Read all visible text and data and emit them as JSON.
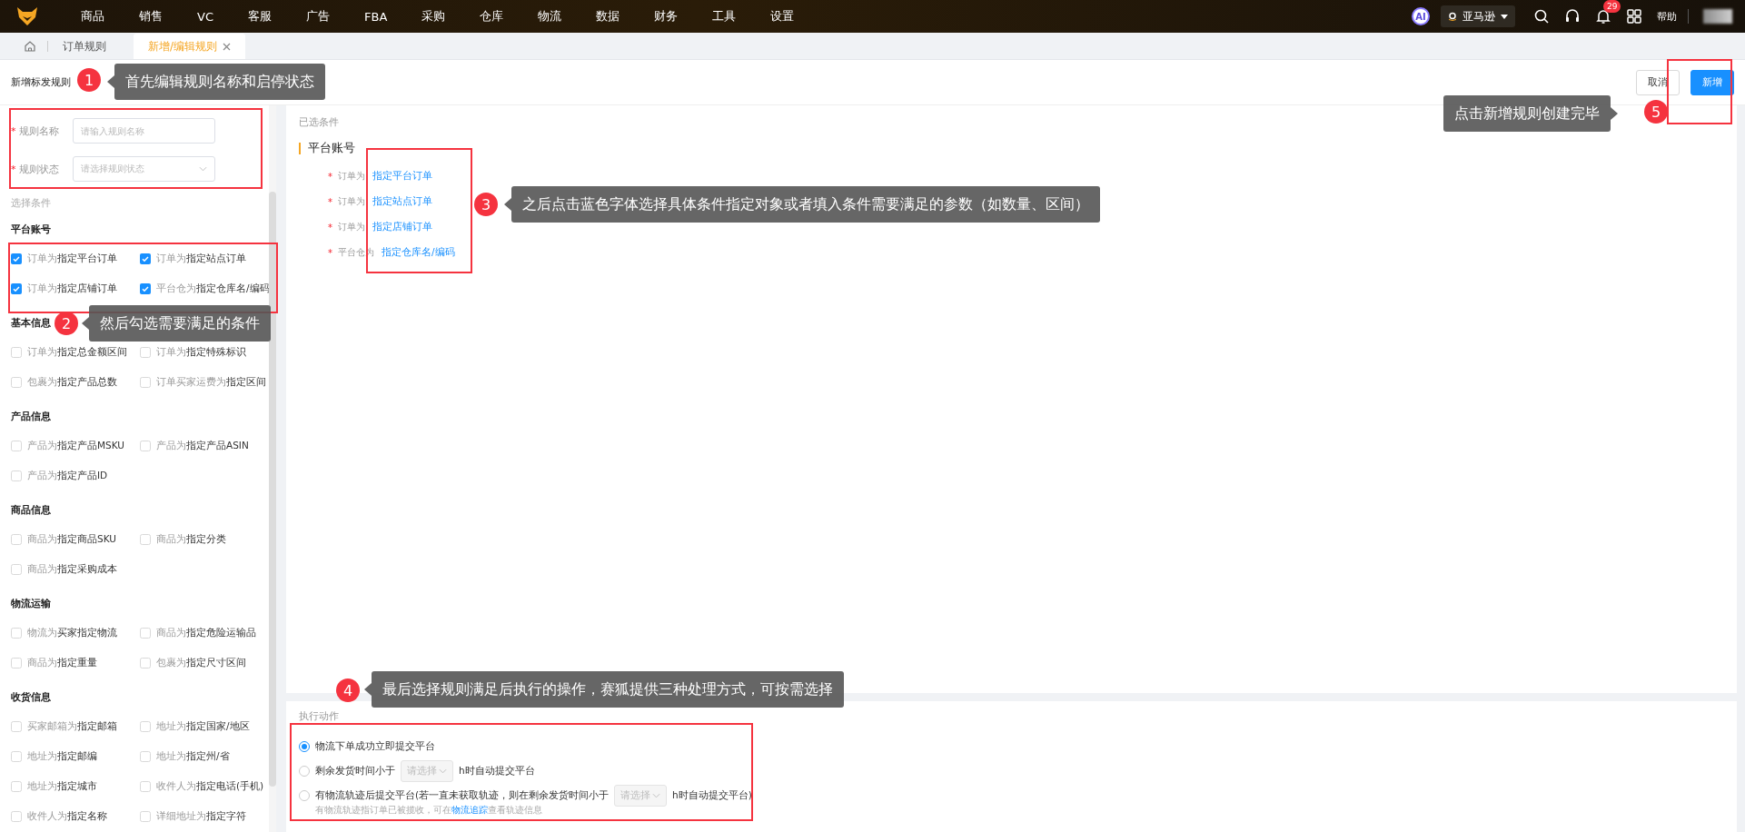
{
  "top_nav": {
    "items": [
      "商品",
      "销售",
      "VC",
      "客服",
      "广告",
      "FBA",
      "采购",
      "仓库",
      "物流",
      "数据",
      "财务",
      "工具",
      "设置"
    ],
    "store": "亚马逊",
    "notification_count": "29",
    "ai": "AI",
    "help": "帮助"
  },
  "tabs": [
    {
      "label": "订单规则",
      "selected": false,
      "closable": false
    },
    {
      "label": "新增/编辑规则",
      "selected": true,
      "closable": true
    }
  ],
  "page_title": "新增标发规则",
  "buttons": [
    {
      "label": "取消",
      "kind": "default"
    },
    {
      "label": "新增",
      "kind": "primary"
    }
  ],
  "form": {
    "fields": [
      {
        "label": "规则名称",
        "required_mark": "*",
        "kind": "input",
        "placeholder": "请输入规则名称"
      },
      {
        "label": "规则状态",
        "required_mark": "*",
        "kind": "select",
        "placeholder": "请选择规则状态"
      }
    ]
  },
  "conditions": {
    "title": "选择条件",
    "groups": [
      {
        "title": "平台账号",
        "items": [
          {
            "label": "订单为**指定平台订单**",
            "checked": true
          },
          {
            "label": "订单为**指定站点订单**",
            "checked": true
          },
          {
            "label": "订单为**指定店铺订单**",
            "checked": true
          },
          {
            "label": "平台仓为**指定仓库名/编码**",
            "checked": true
          }
        ]
      },
      {
        "title": "基本信息",
        "items": [
          {
            "label": "订单为**指定总金额区间**",
            "checked": false
          },
          {
            "label": "订单为**指定特殊标识**",
            "checked": false
          },
          {
            "label": "包裹为**指定产品总数**",
            "checked": false
          },
          {
            "label": "订单买家运费为**指定区间**",
            "checked": false
          }
        ]
      },
      {
        "title": "产品信息",
        "items": [
          {
            "label": "产品为**指定产品MSKU**",
            "checked": false
          },
          {
            "label": "产品为**指定产品ASIN**",
            "checked": false
          },
          {
            "label": "产品为**指定产品ID**",
            "checked": false
          }
        ]
      },
      {
        "title": "商品信息",
        "items": [
          {
            "label": "商品为**指定商品SKU**",
            "checked": false
          },
          {
            "label": "商品为**指定分类**",
            "checked": false
          },
          {
            "label": "商品为**指定采购成本**",
            "checked": false
          }
        ]
      },
      {
        "title": "物流运输",
        "items": [
          {
            "label": "物流为**买家指定物流**",
            "checked": false
          },
          {
            "label": "商品为**指定危险运输品**",
            "checked": false
          },
          {
            "label": "商品为**指定重量**",
            "checked": false
          },
          {
            "label": "包裹为**指定尺寸区间**",
            "checked": false
          }
        ]
      },
      {
        "title": "收货信息",
        "items": [
          {
            "label": "买家邮箱为**指定邮箱**",
            "checked": false
          },
          {
            "label": "地址为**指定国家/地区**",
            "checked": false
          },
          {
            "label": "地址为**指定邮编**",
            "checked": false
          },
          {
            "label": "地址为**指定州/省**",
            "checked": false
          },
          {
            "label": "地址为**指定城市**",
            "checked": false
          },
          {
            "label": "收件人为**指定电话(手机)**",
            "checked": false
          },
          {
            "label": "收件人为**指定名称**",
            "checked": false
          },
          {
            "label": "详细地址为**指定字符**",
            "checked": false
          }
        ]
      }
    ]
  },
  "selected_conditions": {
    "title": "已选条件",
    "group": "平台账号",
    "rows": [
      {
        "required_mark": "*",
        "prefix": "订单为",
        "link": "指定平台订单"
      },
      {
        "required_mark": "*",
        "prefix": "订单为",
        "link": "指定站点订单"
      },
      {
        "required_mark": "*",
        "prefix": "订单为",
        "link": "指定店铺订单"
      },
      {
        "required_mark": "*",
        "prefix": "平台仓为",
        "link": "指定仓库名/编码"
      }
    ]
  },
  "actions": {
    "title": "执行动作",
    "options": [
      {
        "selected": true,
        "before": "物流下单成功立即提交平台"
      },
      {
        "selected": false,
        "before": "剩余发货时间小于",
        "select_placeholder": "请选择",
        "after": "h时自动提交平台"
      },
      {
        "selected": false,
        "before": "有物流轨迹后提交平台(若一直未获取轨迹，则在剩余发货时间小于",
        "select_placeholder": "请选择",
        "after": "h时自动提交平台)",
        "note": {
          "before": "有物流轨迹指订单已被揽收，可在",
          "link": "物流追踪",
          "after": "查看轨迹信息"
        }
      }
    ]
  },
  "annotations": [
    {
      "number": "1",
      "text": "首先编辑规则名称和启停状态"
    },
    {
      "number": "2",
      "text": "然后勾选需要满足的条件"
    },
    {
      "number": "3",
      "text": "之后点击蓝色字体选择具体条件指定对象或者填入条件需要满足的参数（如数量、区间）"
    },
    {
      "number": "4",
      "text": "最后选择规则满足后执行的操作，赛狐提供三种处理方式，可按需选择"
    },
    {
      "number": "5",
      "text": "点击新增规则创建完毕"
    }
  ]
}
